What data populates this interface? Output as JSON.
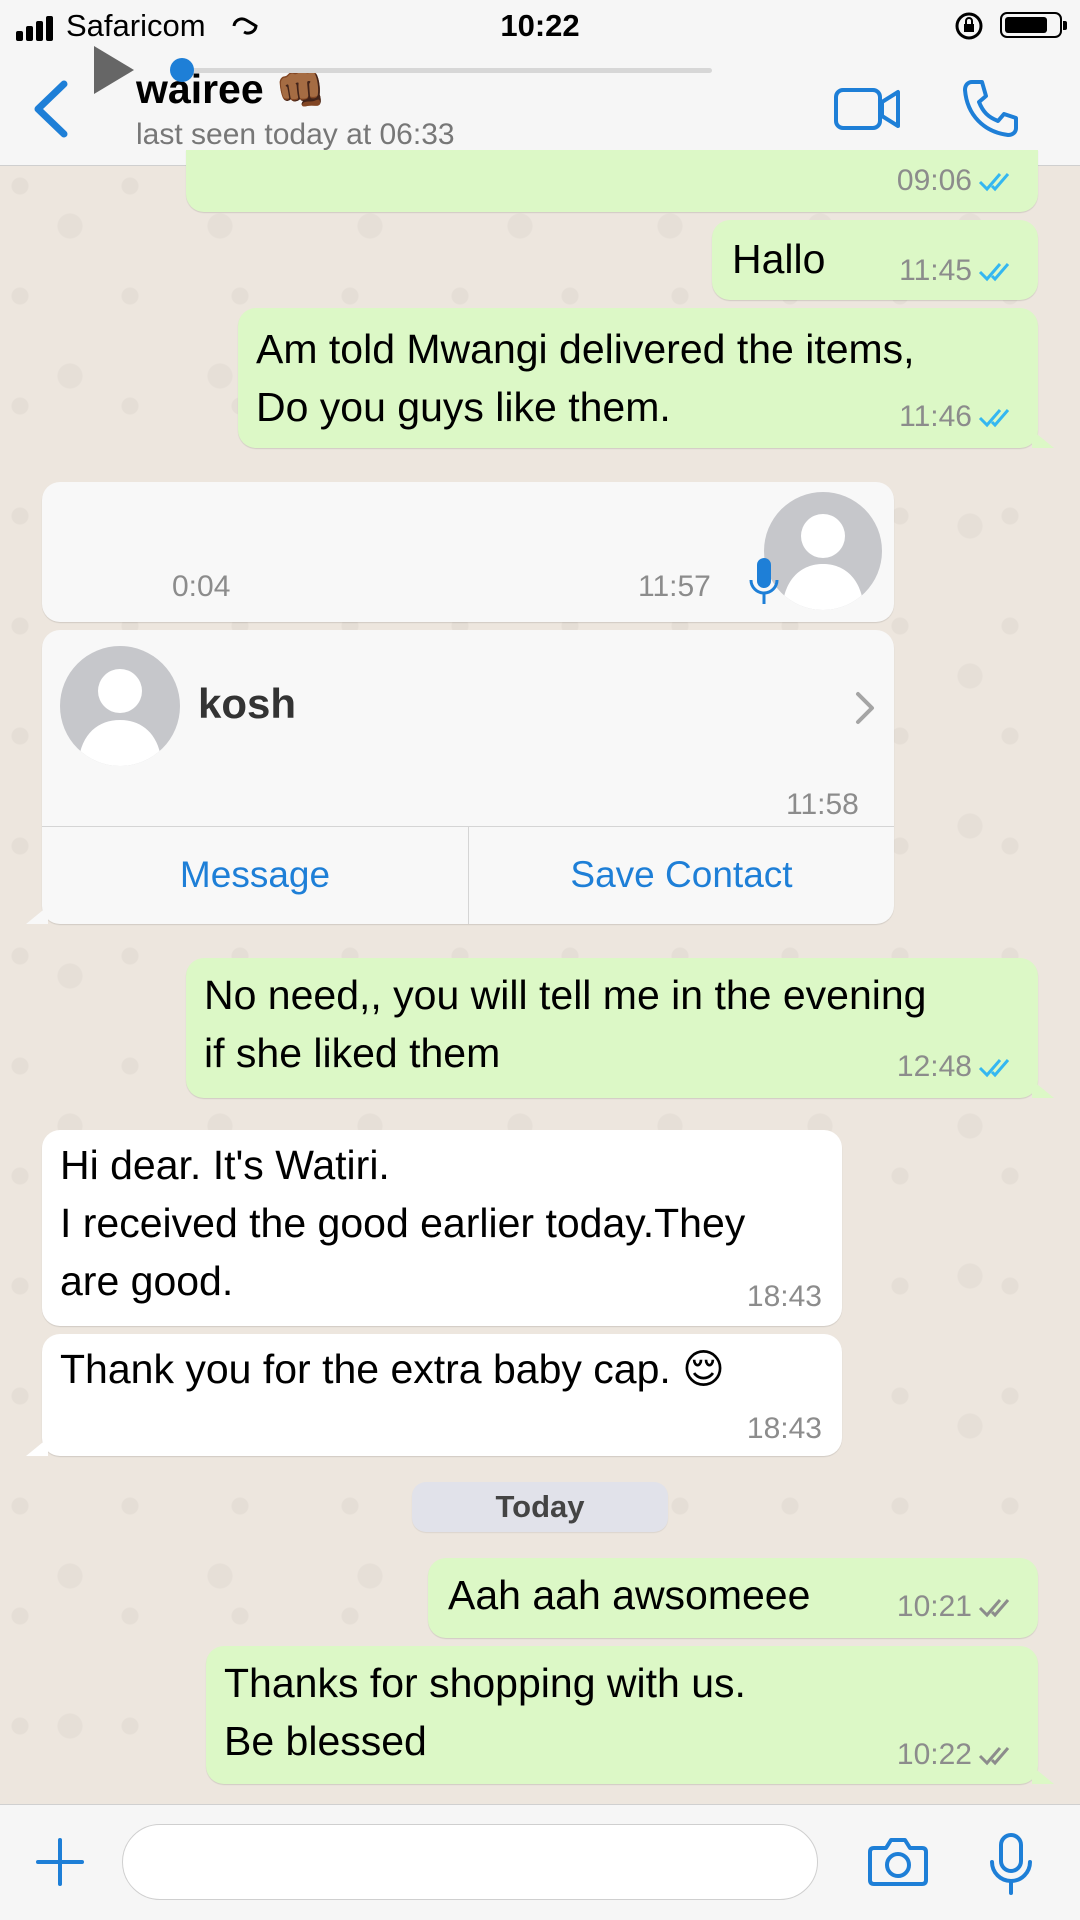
{
  "status_bar": {
    "carrier": "Safaricom",
    "time": "10:22"
  },
  "header": {
    "contact_name": "wairee 👊🏾",
    "last_seen": "last seen today at 06:33"
  },
  "messages": [
    {
      "direction": "out",
      "text": "",
      "time": "09:06",
      "status": "read"
    },
    {
      "direction": "out",
      "text": "Hallo",
      "time": "11:45",
      "status": "read"
    },
    {
      "direction": "out",
      "text": "Am told Mwangi delivered the items,\nDo you guys like them.",
      "time": "11:46",
      "status": "read"
    },
    {
      "direction": "out",
      "text": "No need,, you will tell me in the evening\nif she liked them",
      "time": "12:48",
      "status": "read"
    },
    {
      "direction": "in",
      "text": "Hi dear. It's Watiri.\nI received the good earlier today.They\nare good.",
      "time": "18:43"
    },
    {
      "direction": "in",
      "text": "Thank you for the extra baby cap. 😌",
      "time": "18:43"
    },
    {
      "direction": "out",
      "text": "Aah aah awsomeee",
      "time": "10:21",
      "status": "delivered"
    },
    {
      "direction": "out",
      "text": "Thanks for shopping with us.\nBe blessed",
      "time": "10:22",
      "status": "delivered"
    }
  ],
  "voice_note": {
    "duration": "0:04",
    "time": "11:57",
    "progress": 0.0
  },
  "contact_card": {
    "name": "kosh",
    "time": "11:58",
    "message_label": "Message",
    "save_label": "Save Contact"
  },
  "date_separator": "Today",
  "input": {
    "placeholder": ""
  },
  "colors": {
    "accent": "#1E7FD7",
    "outgoing_bubble": "#DCF8C6",
    "incoming_bubble": "#FFFFFF",
    "read_tick": "#34B7F1",
    "chat_background": "#ECE5DD"
  },
  "icons": [
    "back-chevron-icon",
    "video-call-icon",
    "phone-icon",
    "play-icon",
    "microphone-icon",
    "chevron-right-icon",
    "plus-icon",
    "camera-icon",
    "double-check-icon"
  ]
}
